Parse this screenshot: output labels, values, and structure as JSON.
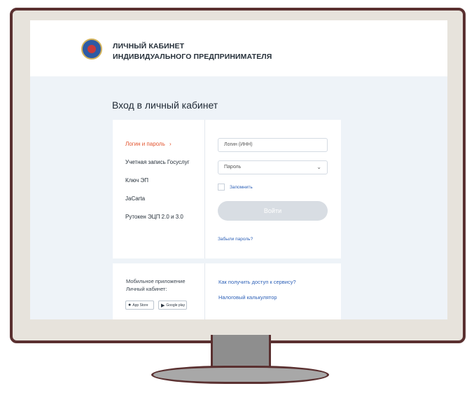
{
  "header": {
    "brand_line1": "ЛИЧНЫЙ КАБИНЕТ",
    "brand_line2": "ИНДИВИДУАЛЬНОГО ПРЕДПРИНИМАТЕЛЯ"
  },
  "page": {
    "title": "Вход в личный кабинет"
  },
  "methods": [
    {
      "label": "Логин и пароль",
      "active": true
    },
    {
      "label": "Учетная запись Госуслуг"
    },
    {
      "label": "Ключ ЭП"
    },
    {
      "label": "JaCarta"
    },
    {
      "label": "Рутокен ЭЦП 2.0 и 3.0"
    }
  ],
  "active_marker": "›",
  "form": {
    "login_placeholder": "Логин (ИНН)",
    "password_placeholder": "Пароль",
    "remember_label": "Запомнить",
    "login_button": "Войти",
    "forgot_link": "Забыли пароль?"
  },
  "footer": {
    "mobile_line1": "Мобильное приложение",
    "mobile_line2": "Личный кабинет:",
    "app_store": "App Store",
    "google_play": "Google play",
    "access_link": "Как получить доступ к сервису?",
    "calculator_link": "Налоговый калькулятор"
  },
  "colors": {
    "accent": "#e2532d",
    "link": "#2f62b8",
    "background": "#eef3f8",
    "button_disabled": "#d8dde3"
  },
  "icons": [
    "emblem-icon",
    "chevron-down-icon",
    "apple-icon",
    "google-play-icon"
  ]
}
